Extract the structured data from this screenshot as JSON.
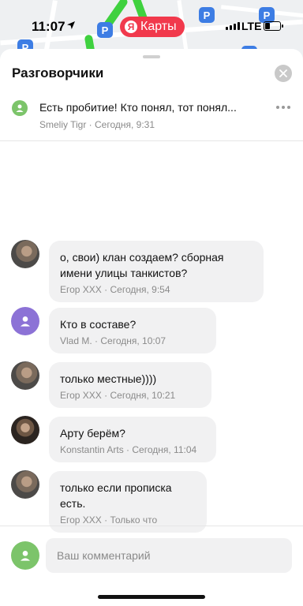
{
  "status_bar": {
    "time": "11:07",
    "app_badge": "Карты",
    "app_badge_logo": "Я",
    "network": "LTE",
    "battery_level": 0.35
  },
  "map": {
    "parking_symbol": "P"
  },
  "sheet": {
    "title": "Разговорчики",
    "topic": {
      "text": "Есть пробитие! Кто понял, тот понял...",
      "author": "Smeliy Tigr",
      "time": "Сегодня, 9:31"
    }
  },
  "comments": [
    {
      "text": "о, свои) клан создаем? сборная имени улицы танкистов?",
      "author": "Егор XXX",
      "time": "Сегодня, 9:54"
    },
    {
      "text": "Кто в составе?",
      "author": "Vlad M.",
      "time": "Сегодня, 10:07"
    },
    {
      "text": "только местные))))",
      "author": "Егор XXX",
      "time": "Сегодня, 10:21"
    },
    {
      "text": "Арту берём?",
      "author": "Konstantin Arts",
      "time": "Сегодня, 11:04"
    },
    {
      "text": "только если прописка есть.",
      "author": "Егор XXX",
      "time": "Только что"
    }
  ],
  "composer": {
    "placeholder": "Ваш комментарий"
  },
  "meta_separator": " · ",
  "colors": {
    "accent_green": "#7cc46a",
    "badge_red": "#f1394c",
    "avatar_purple": "#8c72d6",
    "bubble_gray": "#f1f1f2",
    "parking_blue": "#3d7de4",
    "route_green": "#3fd13f"
  },
  "icons": [
    "location-arrow-icon",
    "yandex-logo-icon",
    "close-icon",
    "user-icon",
    "more-icon",
    "parking-icon"
  ]
}
